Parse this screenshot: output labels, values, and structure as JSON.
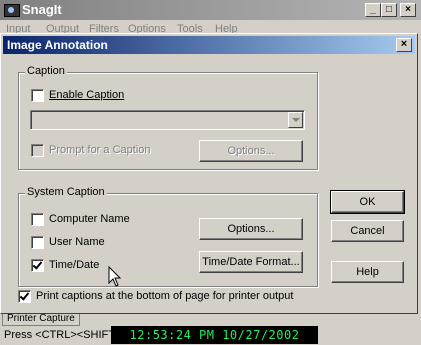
{
  "outer_window": {
    "title": "SnagIt",
    "menu": [
      "Input",
      "Output",
      "Filters",
      "Options",
      "Tools",
      "Help"
    ],
    "minimize": "_",
    "maximize": "□",
    "close": "×"
  },
  "dialog": {
    "title": "Image Annotation",
    "close": "×",
    "caption_group": {
      "label": "Caption",
      "enable_caption": {
        "label": "Enable Caption",
        "checked": false
      },
      "caption_text": "",
      "prompt_for_caption": {
        "label": "Prompt for a Caption",
        "checked": false,
        "disabled": true
      },
      "options_button": "Options..."
    },
    "system_caption_group": {
      "label": "System Caption",
      "computer_name": {
        "label": "Computer Name",
        "checked": false
      },
      "user_name": {
        "label": "User Name",
        "checked": false
      },
      "time_date": {
        "label": "Time/Date",
        "checked": true
      },
      "options_button": "Options...",
      "time_date_format_button": "Time/Date Format..."
    },
    "print_bottom": {
      "label": "Print captions at the bottom of page for printer output",
      "checked": true
    },
    "ok_button": "OK",
    "cancel_button": "Cancel",
    "help_button": "Help"
  },
  "tab_strip": {
    "tab": "Printer Capture"
  },
  "status_bar": {
    "text": "Press  <CTRL><SHIFT",
    "clock": "12:53:24 PM 10/27/2002"
  }
}
